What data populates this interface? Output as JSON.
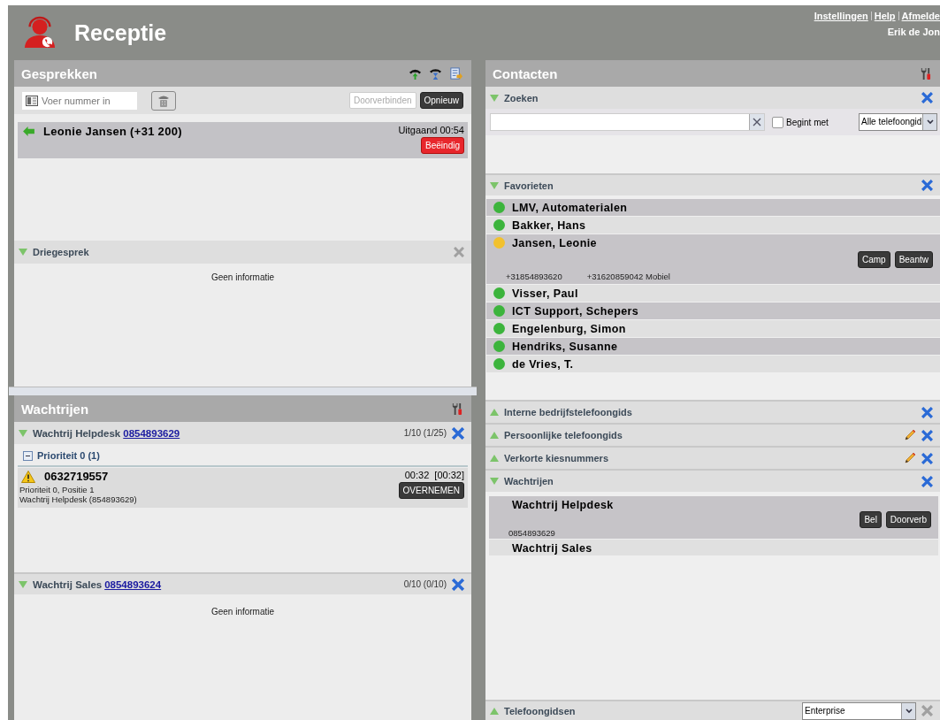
{
  "header": {
    "title": "Receptie",
    "links": [
      "Instellingen",
      "Help",
      "Afmelde"
    ],
    "user": "Erik de Jon"
  },
  "calls": {
    "title": "Gesprekken",
    "number_field": {
      "placeholder": "Voer nummer in"
    },
    "buttons": [
      {
        "label": "Doorverbinden",
        "disabled": true
      },
      {
        "label": "Opnieuw",
        "disabled": false
      }
    ],
    "active_call": {
      "caller": "Leonie Jansen (+31 200)",
      "status": "Uitgaand 00:54",
      "end_button": "Beëindig"
    },
    "conference": {
      "title": "Driegesprek",
      "expanded": true,
      "closable": false,
      "empty_text": "Geen informatie"
    }
  },
  "queues": {
    "title": "Wachtrijen",
    "items": [
      {
        "name": "Wachtrij Helpdesk",
        "number": "0854893629",
        "count": "1/10 (1/25)",
        "expanded": true,
        "closable": true,
        "groups": [
          {
            "label": "Prioriteit 0 (1)",
            "expanded": true,
            "callers": [
              {
                "number": "0632719557",
                "time": "00:32  [00:32]",
                "line_1": "Prioriteit 0, Positie 1",
                "line_2": "Wachtrij Helpdesk (854893629)",
                "button": "OVERNEMEN"
              }
            ]
          }
        ]
      },
      {
        "name": "Wachtrij Sales",
        "number": "0854893624",
        "count": "0/10 (0/10)",
        "expanded": true,
        "closable": true,
        "empty_text": "Geen informatie"
      }
    ]
  },
  "contacts": {
    "title": "Contacten",
    "search": {
      "title": "Zoeken",
      "expanded": true,
      "closable": true,
      "checkbox": {
        "label": "Begint met",
        "checked": false
      },
      "phonebook": "Alle telefoongid"
    },
    "favorites": {
      "title": "Favorieten",
      "expanded": true,
      "closable": true,
      "items": [
        {
          "name": "LMV, Automaterialen",
          "color": "#3cb43c"
        },
        {
          "name": "Bakker, Hans",
          "color": "#3cb43c"
        },
        {
          "name": "Jansen, Leonie",
          "color": "#f2c12e",
          "numbers": [
            "+31854893620",
            "+31620859042 Mobiel"
          ],
          "buttons": [
            "Camp",
            "Beantw"
          ]
        },
        {
          "name": "Visser, Paul",
          "color": "#3cb43c"
        },
        {
          "name": "ICT Support, Schepers",
          "color": "#3cb43c"
        },
        {
          "name": "Engelenburg, Simon",
          "color": "#3cb43c"
        },
        {
          "name": "Hendriks, Susanne",
          "color": "#3cb43c"
        },
        {
          "name": "de Vries, T.",
          "color": "#3cb43c"
        }
      ]
    },
    "sections": [
      {
        "title": "Interne bedrijfstelefoongids",
        "expanded": false,
        "closable": true,
        "editable": false
      },
      {
        "title": "Persoonlijke telefoongids",
        "expanded": false,
        "closable": true,
        "editable": true
      },
      {
        "title": "Verkorte kiesnummers",
        "expanded": false,
        "closable": true,
        "editable": true
      }
    ],
    "queues": {
      "title": "Wachtrijen",
      "expanded": true,
      "closable": true,
      "items": [
        {
          "name": "Wachtrij Helpdesk",
          "number": "0854893629",
          "buttons": [
            "Bel",
            "Doorverb"
          ]
        },
        {
          "name": "Wachtrij Sales"
        }
      ]
    },
    "phonebooks": {
      "title": "Telefoongidsen",
      "expanded": false,
      "closable": false,
      "value": "Enterprise"
    }
  }
}
